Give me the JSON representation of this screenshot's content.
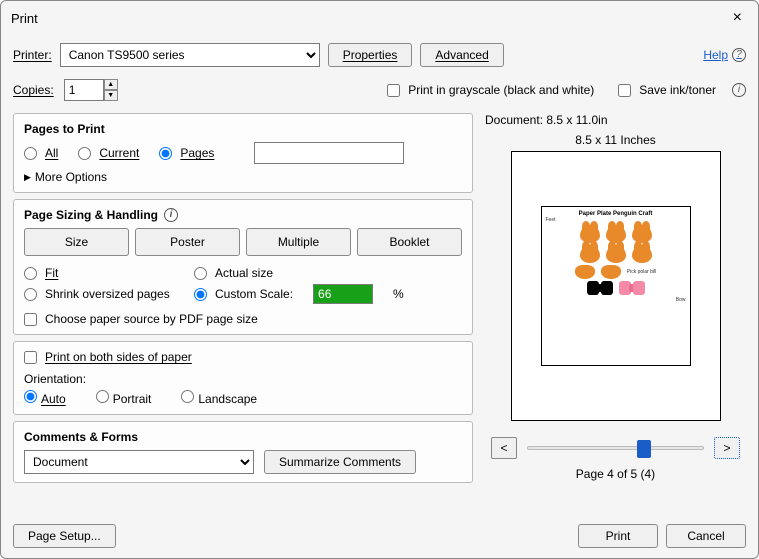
{
  "dialog": {
    "title": "Print",
    "close_icon": "×"
  },
  "top": {
    "printer_label": "Printer:",
    "printer_value": "Canon TS9500 series",
    "properties_btn": "Properties",
    "advanced_btn": "Advanced",
    "help_link": "Help"
  },
  "copies": {
    "label": "Copies:",
    "value": "1",
    "grayscale_label": "Print in grayscale (black and white)",
    "saveink_label": "Save ink/toner"
  },
  "pages_to_print": {
    "title": "Pages to Print",
    "all": "All",
    "current": "Current",
    "pages": "Pages",
    "pages_value": "",
    "selected": "pages",
    "more_options": "More Options"
  },
  "sizing": {
    "title": "Page Sizing & Handling",
    "size_btn": "Size",
    "poster_btn": "Poster",
    "multiple_btn": "Multiple",
    "booklet_btn": "Booklet",
    "fit": "Fit",
    "actual": "Actual size",
    "shrink": "Shrink oversized pages",
    "custom": "Custom Scale:",
    "custom_value": "66",
    "percent": "%",
    "selected": "custom",
    "paper_source": "Choose paper source by PDF page size",
    "both_sides": "Print on both sides of paper"
  },
  "orientation": {
    "label": "Orientation:",
    "auto": "Auto",
    "portrait": "Portrait",
    "landscape": "Landscape",
    "selected": "auto"
  },
  "comments": {
    "title": "Comments & Forms",
    "value": "Document",
    "summarize_btn": "Summarize Comments"
  },
  "preview": {
    "doc_dim": "Document: 8.5 x 11.0in",
    "paper_label": "8.5 x 11 Inches",
    "craft_title": "Paper Plate Penguin Craft",
    "feet_label": "Feet",
    "bill_label": "Pick polar bill",
    "bow_label": "Bow",
    "prev": "<",
    "next": ">",
    "page_of": "Page 4 of 5 (4)"
  },
  "footer": {
    "page_setup": "Page Setup...",
    "print": "Print",
    "cancel": "Cancel"
  }
}
